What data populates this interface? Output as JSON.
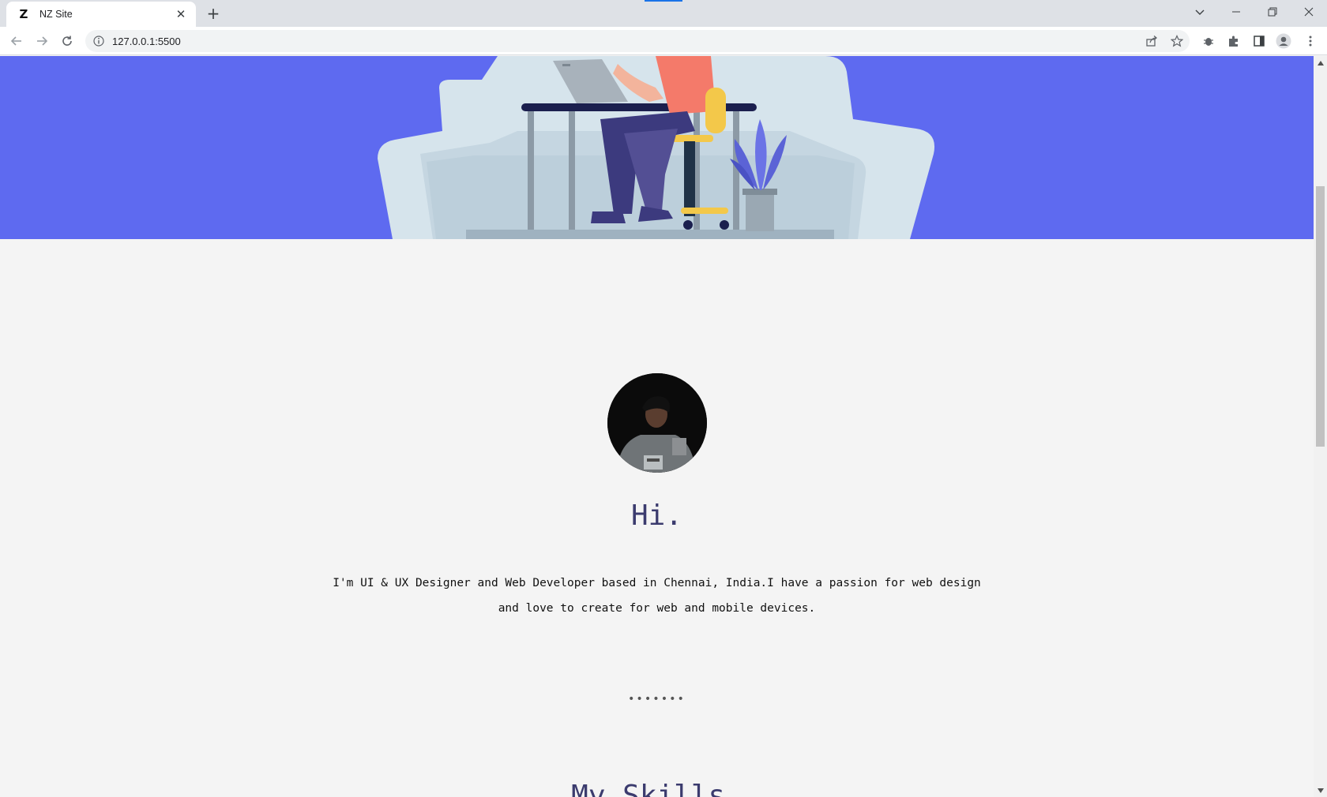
{
  "browser": {
    "tab_title": "NZ Site",
    "tab_favicon_letter": "Z",
    "tab_close_glyph": "✕",
    "new_tab_glyph": "+",
    "url": "127.0.0.1:5500",
    "window_controls": {
      "dropdown": "⌄",
      "minimize": "—",
      "restore": "❐",
      "close": "✕"
    }
  },
  "page": {
    "hero_colors": {
      "background": "#5e6af0"
    },
    "avatar_alt": "",
    "greeting": "Hi.",
    "intro_line1": "I'm UI & UX Designer and Web Developer based in Chennai, India.I have a passion for web design",
    "intro_line2": "and love to create for web and mobile devices.",
    "divider_dots": "•••••••",
    "skills_title": "My Skills."
  },
  "scrollbar": {
    "up_arrow": "▲",
    "down_arrow": "▼"
  }
}
